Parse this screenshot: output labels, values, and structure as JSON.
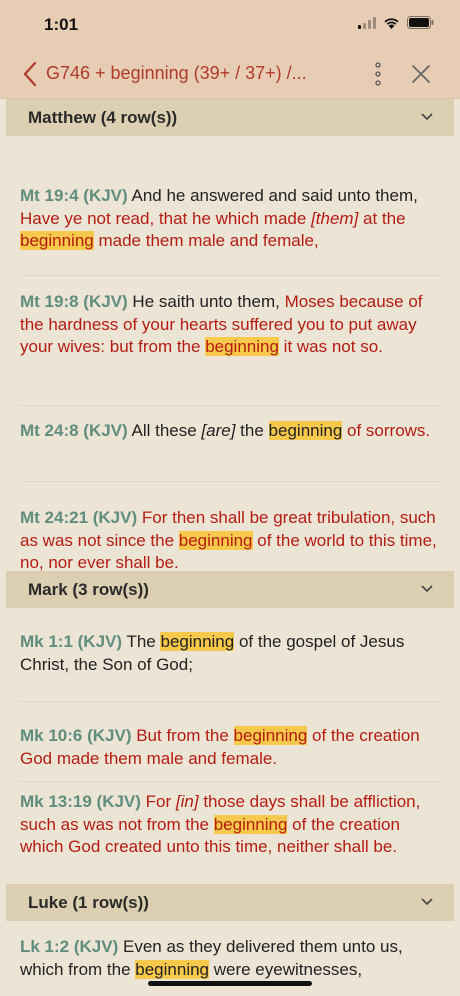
{
  "status": {
    "time": "1:01"
  },
  "nav": {
    "title": "G746 + beginning    (39+ / 37+) /..."
  },
  "sections": [
    {
      "title": "Matthew (4 row(s))",
      "verses": [
        {
          "ref": "Mt 19:4 (KJV)",
          "parts": [
            {
              "t": "And he answered and said unto them, ",
              "s": ""
            },
            {
              "t": "Have ye not read, that he which made ",
              "s": "red"
            },
            {
              "t": "[them]",
              "s": "red ital"
            },
            {
              "t": " at the ",
              "s": "red"
            },
            {
              "t": "beginning",
              "s": "red hl"
            },
            {
              "t": " made them male and female,",
              "s": "red"
            }
          ]
        },
        {
          "ref": "Mt 19:8 (KJV)",
          "parts": [
            {
              "t": "He saith unto them, ",
              "s": ""
            },
            {
              "t": "Moses because of the hardness of your hearts suffered you to put away your wives: but from the ",
              "s": "red"
            },
            {
              "t": "beginning",
              "s": "red hl"
            },
            {
              "t": " it was not so.",
              "s": "red"
            }
          ]
        },
        {
          "ref": "Mt 24:8 (KJV)",
          "parts": [
            {
              "t": "All these ",
              "s": ""
            },
            {
              "t": "[are]",
              "s": "ital"
            },
            {
              "t": " the ",
              "s": ""
            },
            {
              "t": "beginning",
              "s": "hl"
            },
            {
              "t": " of sorrows.",
              "s": "red"
            }
          ]
        },
        {
          "ref": "Mt 24:21 (KJV)",
          "parts": [
            {
              "t": "For then shall be great tribulation, such as was not since the ",
              "s": "red"
            },
            {
              "t": "beginning",
              "s": "red hl"
            },
            {
              "t": " of the world to this time, no, nor ever shall be.",
              "s": "red"
            }
          ]
        }
      ]
    },
    {
      "title": "Mark (3 row(s))",
      "verses": [
        {
          "ref": "Mk 1:1 (KJV)",
          "parts": [
            {
              "t": "The ",
              "s": ""
            },
            {
              "t": "beginning",
              "s": "hl"
            },
            {
              "t": " of the gospel of Jesus Christ, the Son of God;",
              "s": ""
            }
          ]
        },
        {
          "ref": "Mk 10:6 (KJV)",
          "parts": [
            {
              "t": "But from the ",
              "s": "red"
            },
            {
              "t": "beginning",
              "s": "red hl"
            },
            {
              "t": " of the creation God made them male and female.",
              "s": "red"
            }
          ]
        },
        {
          "ref": "Mk 13:19 (KJV)",
          "parts": [
            {
              "t": "For ",
              "s": "red"
            },
            {
              "t": "[in]",
              "s": "red ital"
            },
            {
              "t": " those days shall be affliction, such as was not from the ",
              "s": "red"
            },
            {
              "t": "beginning",
              "s": "red hl"
            },
            {
              "t": " of the creation which God created unto this time, neither shall be.",
              "s": "red"
            }
          ]
        }
      ]
    },
    {
      "title": "Luke (1 row(s))",
      "verses": [
        {
          "ref": "Lk 1:2 (KJV)",
          "parts": [
            {
              "t": "Even as they delivered them unto us, which from the ",
              "s": ""
            },
            {
              "t": "beginning",
              "s": "hl"
            },
            {
              "t": " were eyewitnesses,",
              "s": ""
            }
          ]
        }
      ]
    }
  ],
  "colors": {
    "accent": "#b23a2a",
    "ref": "#5f8d7e",
    "highlight": "#f8c94a",
    "header_bg": "#e8cdb5"
  },
  "icons": [
    "back-chevron-icon",
    "more-vertical-icon",
    "close-icon",
    "chevron-down-icon",
    "signal-icon",
    "wifi-icon",
    "battery-icon"
  ]
}
